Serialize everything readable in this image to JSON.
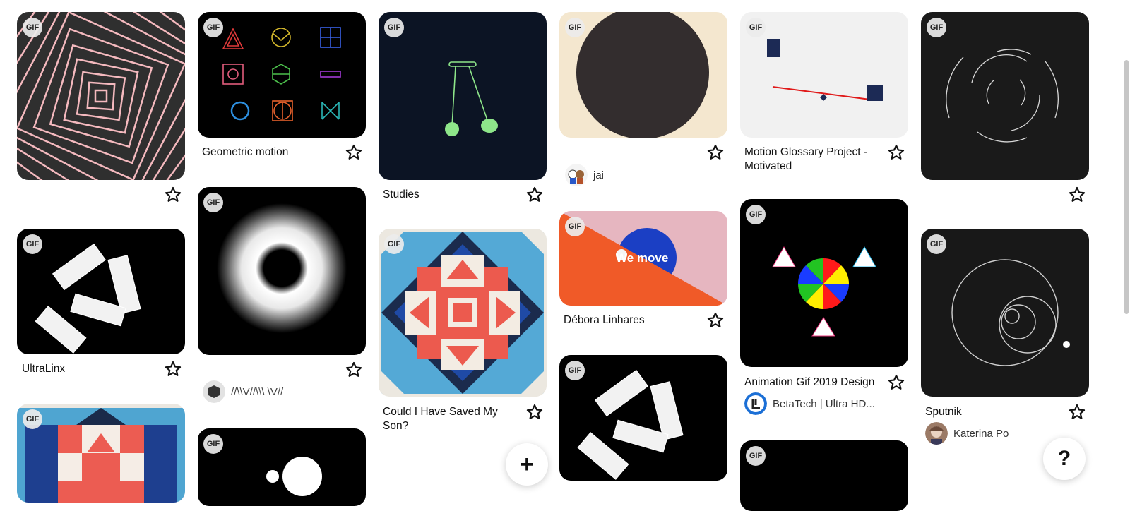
{
  "gif_badge": "GIF",
  "pins": [
    {
      "title": "Geometric motion"
    },
    {
      "title": "Studies"
    },
    {
      "creator": "jai"
    },
    {
      "title": "Motion Glossary Project - Motivated"
    },
    {
      "title": "UltraLinx"
    },
    {
      "creator": "//\\\\V//\\\\\\ \\V//"
    },
    {
      "title": "Débora Linhares",
      "overlay_text": "We move"
    },
    {
      "title": "Animation Gif 2019 Design",
      "creator": "BetaTech | Ultra HD..."
    },
    {
      "title": "Could I Have Saved My Son?"
    },
    {
      "title": "Sputnik",
      "creator": "Katerina Po"
    }
  ],
  "buttons": {
    "add": "+",
    "help": "?"
  },
  "icons": {
    "save": "star-icon",
    "add": "plus-icon",
    "help": "question-icon"
  },
  "colors": {
    "pink_lines": "#f4b9be",
    "dark_bg": "#2f2f2f",
    "navy": "#0c1424",
    "orange": "#f05a28",
    "accent_blue": "#1b3fc4"
  }
}
